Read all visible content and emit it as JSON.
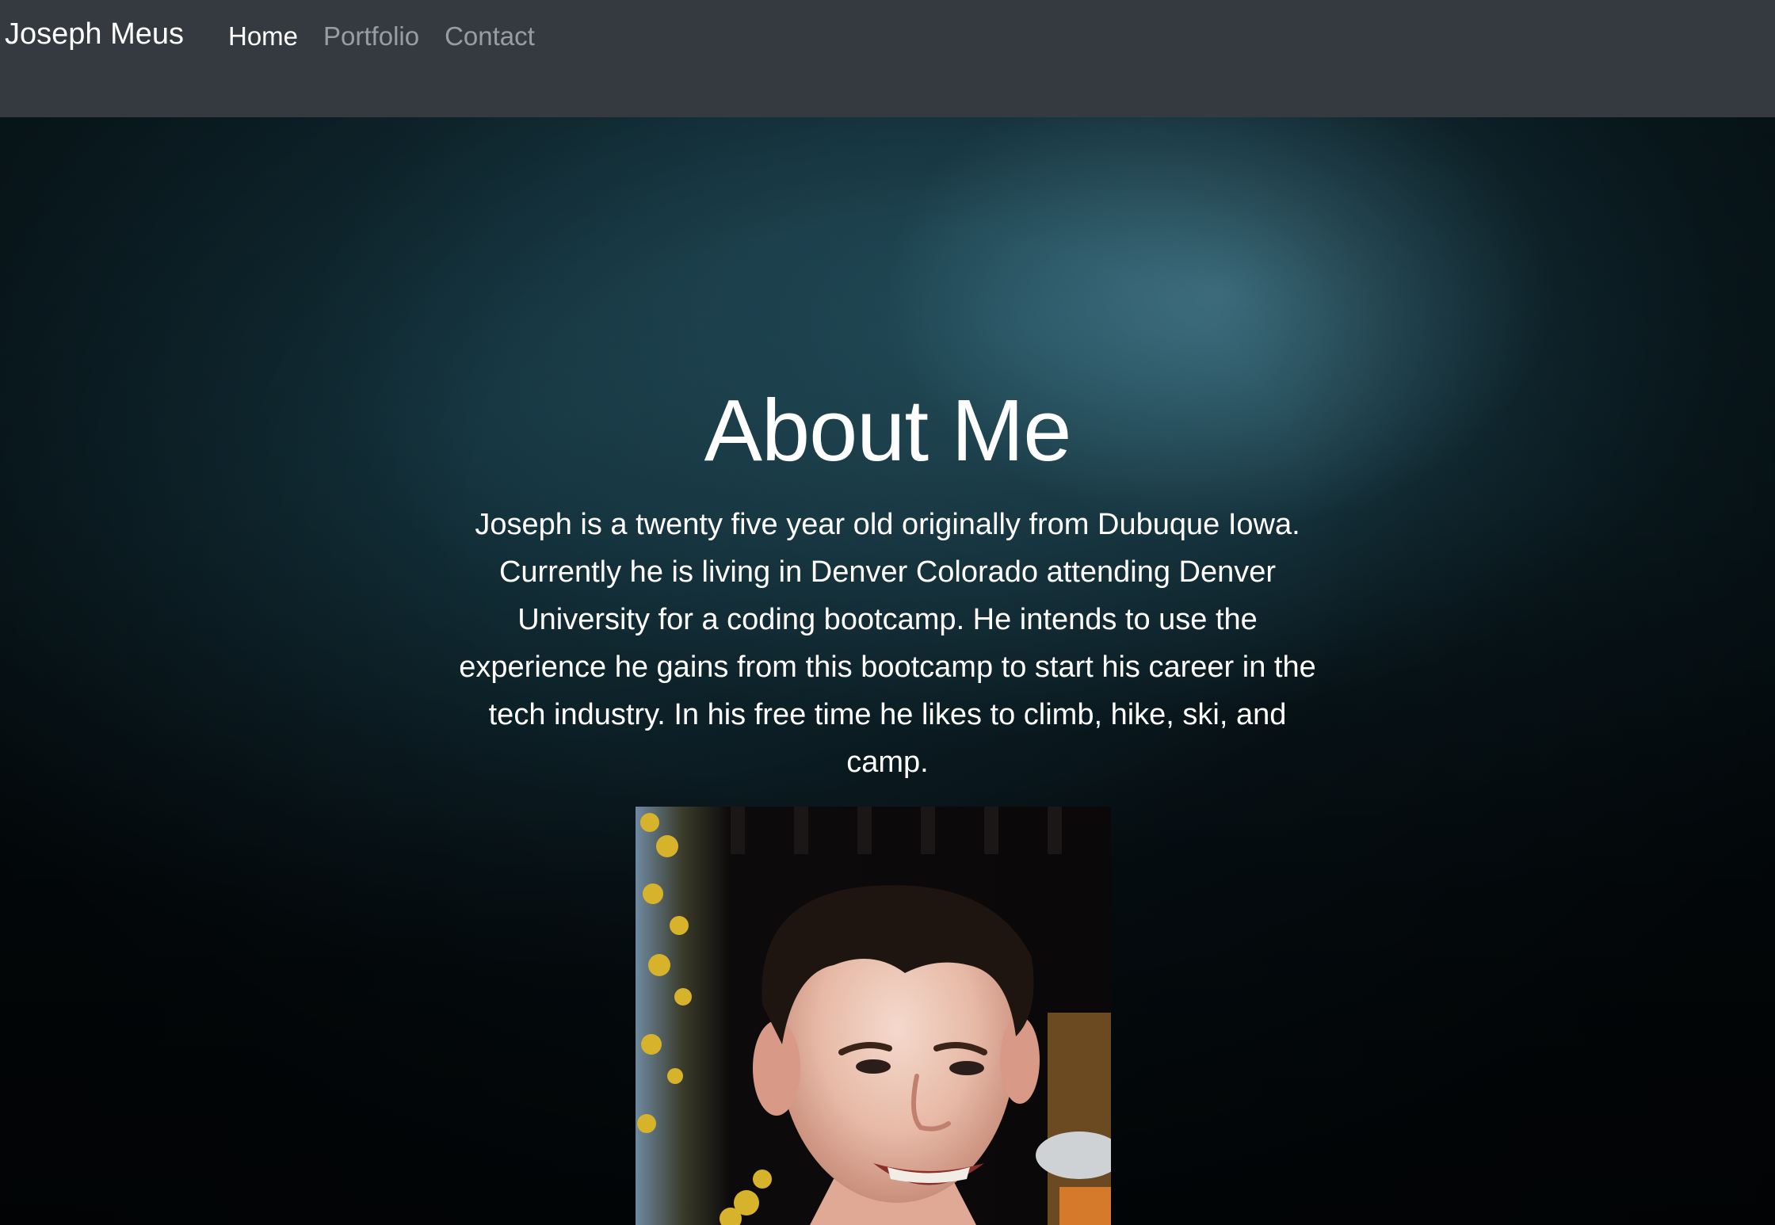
{
  "navbar": {
    "brand": "Joseph Meus",
    "links": [
      {
        "label": "Home",
        "active": true
      },
      {
        "label": "Portfolio",
        "active": false
      },
      {
        "label": "Contact",
        "active": false
      }
    ]
  },
  "about": {
    "title": "About Me",
    "bio": "Joseph is a twenty five year old originally from Dubuque Iowa. Currently he is living in Denver Colorado attending Denver University for a coding bootcamp. He intends to use the experience he gains from this bootcamp to start his career in the tech industry. In his free time he likes to climb, hike, ski, and camp."
  },
  "colors": {
    "navbar_bg": "#343a40",
    "nav_active": "#ffffff",
    "nav_inactive": "rgba(255,255,255,0.5)"
  }
}
